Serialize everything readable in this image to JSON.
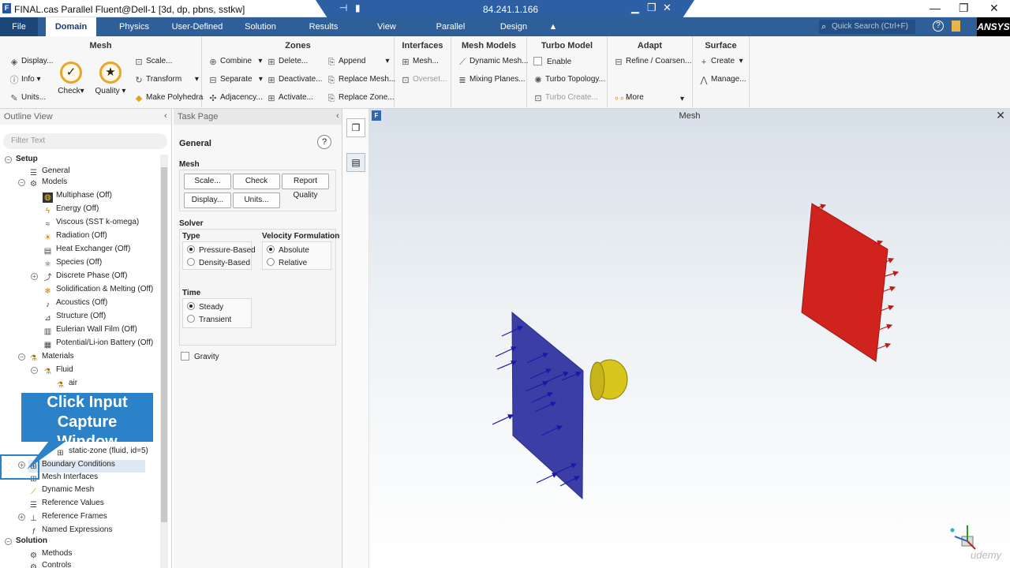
{
  "window": {
    "title": "FINAL.cas Parallel Fluent@Dell-1  [3d, dp, pbns, sstkw]",
    "remote_ip": "84.241.1.166",
    "minimize": "—",
    "maximize": "❐",
    "close": "✕"
  },
  "tabs": [
    {
      "label": "File"
    },
    {
      "label": "Domain"
    },
    {
      "label": "Physics"
    },
    {
      "label": "User-Defined"
    },
    {
      "label": "Solution"
    },
    {
      "label": "Results"
    },
    {
      "label": "View"
    },
    {
      "label": "Parallel"
    },
    {
      "label": "Design"
    }
  ],
  "quick_search": {
    "placeholder": "Quick Search (Ctrl+F)"
  },
  "brand": "ANSYS",
  "ribbon": {
    "mesh": {
      "title": "Mesh",
      "display": "Display...",
      "info": "Info",
      "units": "Units...",
      "check": "Check",
      "quality": "Quality",
      "scale": "Scale...",
      "transform": "Transform",
      "make_polyhedra": "Make Polyhedra"
    },
    "zones": {
      "title": "Zones",
      "combine": "Combine",
      "separate": "Separate",
      "adjacency": "Adjacency...",
      "delete": "Delete...",
      "deactivate": "Deactivate...",
      "activate": "Activate...",
      "append": "Append",
      "replace_mesh": "Replace Mesh...",
      "replace_zone": "Replace Zone..."
    },
    "interfaces": {
      "title": "Interfaces",
      "mesh": "Mesh...",
      "overset": "Overset..."
    },
    "mesh_models": {
      "title": "Mesh Models",
      "dynamic_mesh": "Dynamic Mesh...",
      "mixing_planes": "Mixing Planes..."
    },
    "turbo_model": {
      "title": "Turbo Model",
      "enable": "Enable",
      "turbo_topology": "Turbo Topology...",
      "turbo_create": "Turbo Create..."
    },
    "adapt": {
      "title": "Adapt",
      "refine": "Refine / Coarsen...",
      "more": "More"
    },
    "surface": {
      "title": "Surface",
      "create": "Create",
      "manage": "Manage..."
    }
  },
  "outline": {
    "title": "Outline View",
    "filter_placeholder": "Filter Text",
    "setup": "Setup",
    "general": "General",
    "models": "Models",
    "multiphase": "Multiphase (Off)",
    "energy": "Energy (Off)",
    "viscous": "Viscous (SST k-omega)",
    "radiation": "Radiation (Off)",
    "heat_exchanger": "Heat Exchanger (Off)",
    "species": "Species (Off)",
    "discrete_phase": "Discrete Phase (Off)",
    "solidification": "Solidification & Melting (Off)",
    "acoustics": "Acoustics (Off)",
    "structure": "Structure (Off)",
    "eulerian_wall_film": "Eulerian Wall Film (Off)",
    "battery": "Potential/Li-ion Battery (Off)",
    "materials": "Materials",
    "fluid": "Fluid",
    "air": "air",
    "static_zone": "static-zone (fluid, id=5)",
    "boundary_conditions": "Boundary Conditions",
    "mesh_interfaces": "Mesh Interfaces",
    "dynamic_mesh": "Dynamic Mesh",
    "reference_values": "Reference Values",
    "reference_frames": "Reference Frames",
    "named_expressions": "Named Expressions",
    "solution": "Solution",
    "methods": "Methods",
    "controls": "Controls"
  },
  "callout": {
    "line1": "Click Input",
    "line2": "Capture",
    "line3": "Window"
  },
  "task": {
    "title": "Task Page",
    "heading": "General",
    "mesh_label": "Mesh",
    "scale": "Scale...",
    "check": "Check",
    "report_quality": "Report Quality",
    "display": "Display...",
    "units": "Units...",
    "solver_label": "Solver",
    "type_label": "Type",
    "pressure_based": "Pressure-Based",
    "density_based": "Density-Based",
    "velocity_label": "Velocity Formulation",
    "absolute": "Absolute",
    "relative": "Relative",
    "time_label": "Time",
    "steady": "Steady",
    "transient": "Transient",
    "gravity": "Gravity"
  },
  "viewport": {
    "title": "Mesh",
    "watermark": "udemy"
  },
  "colors": {
    "ribbon_bar": "#2e5f99",
    "inlet": "#3b3fa5",
    "outlet": "#d0231d",
    "body": "#d9c61c",
    "accent": "#2b82c9"
  }
}
